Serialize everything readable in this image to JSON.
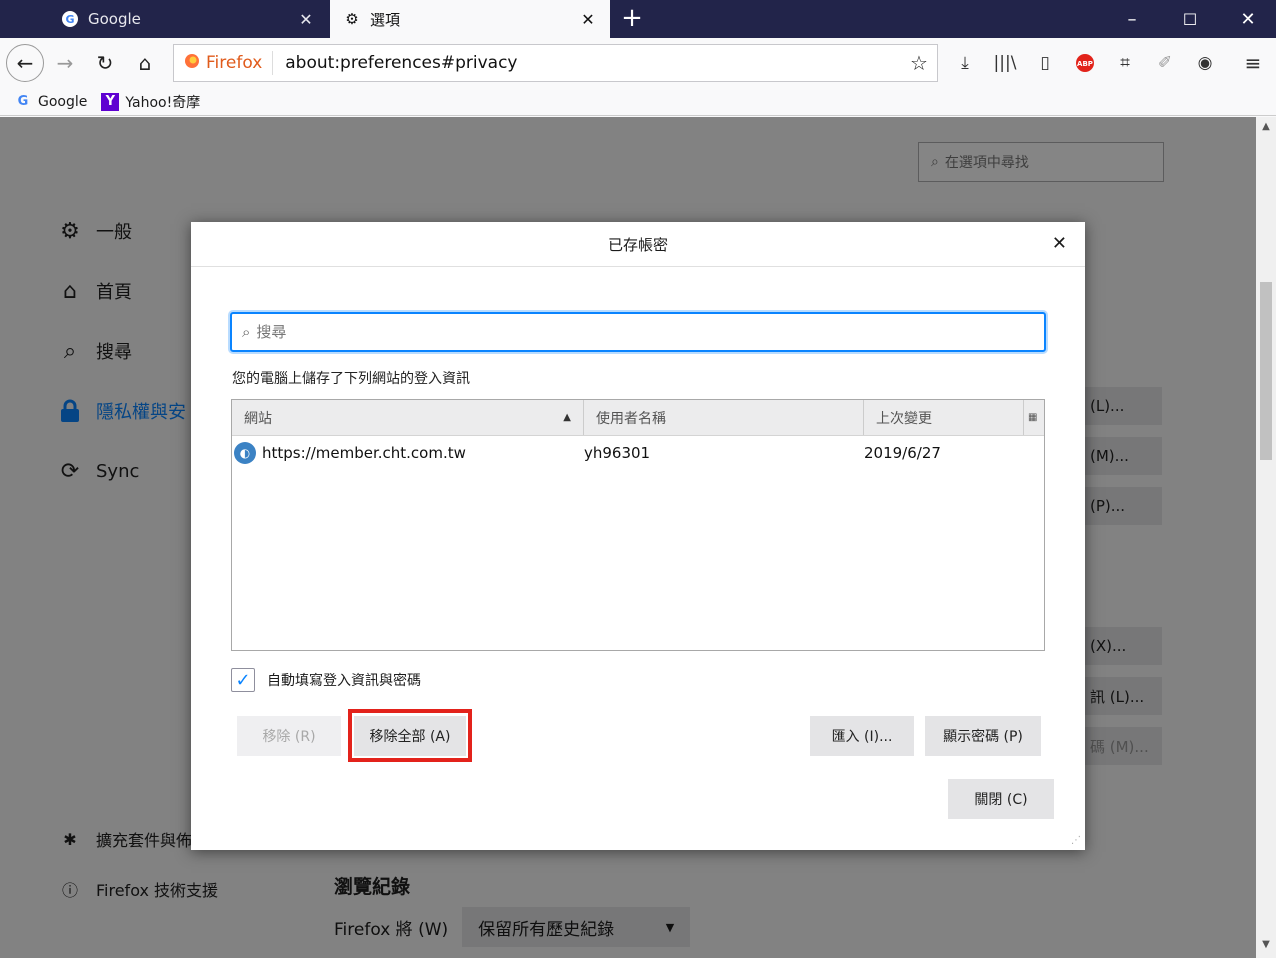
{
  "tabs": [
    {
      "title": "Google",
      "icon": "google-icon"
    },
    {
      "title": "選項",
      "icon": "gear-icon"
    }
  ],
  "window": {
    "minimize": "–",
    "maximize": "☐",
    "close": "✕"
  },
  "urlbar": {
    "identity": "Firefox",
    "url": "about:preferences#privacy"
  },
  "bookmarks": [
    {
      "label": "Google",
      "icon": "google-icon"
    },
    {
      "label": "Yahoo!奇摩",
      "icon": "yahoo-icon"
    }
  ],
  "prefs": {
    "search_placeholder": "在選項中尋找",
    "categories": [
      {
        "label": "一般",
        "icon": "gear-icon"
      },
      {
        "label": "首頁",
        "icon": "home-icon"
      },
      {
        "label": "搜尋",
        "icon": "search-icon"
      },
      {
        "label": "隱私權與安",
        "icon": "lock-icon"
      },
      {
        "label": "Sync",
        "icon": "sync-icon"
      }
    ],
    "footer_links": [
      {
        "label": "擴充套件與佈",
        "icon": "puzzle-icon"
      },
      {
        "label": "Firefox 技術支援",
        "icon": "help-icon"
      }
    ],
    "side_buttons": [
      "(L)...",
      "(M)...",
      "(P)...",
      "(X)...",
      "訊 (L)...",
      "碼 (M)..."
    ],
    "history": {
      "title": "瀏覽紀錄",
      "label": "Firefox 將 (W)",
      "selected": "保留所有歷史紀錄"
    }
  },
  "dialog": {
    "title": "已存帳密",
    "search_placeholder": "搜尋",
    "description": "您的電腦上儲存了下列網站的登入資訊",
    "columns": {
      "site": "網站",
      "username": "使用者名稱",
      "changed": "上次變更"
    },
    "rows": [
      {
        "site": "https://member.cht.com.tw",
        "username": "yh96301",
        "changed": "2019/6/27"
      }
    ],
    "autofill_label": "自動填寫登入資訊與密碼",
    "autofill_checked": true,
    "buttons": {
      "remove": "移除 (R)",
      "remove_all": "移除全部 (A)",
      "import": "匯入 (I)...",
      "show_passwords": "顯示密碼 (P)",
      "close": "關閉 (C)"
    }
  },
  "colors": {
    "tabbar": "#22244a",
    "accent": "#0a84ff",
    "highlight": "#e3221b"
  }
}
